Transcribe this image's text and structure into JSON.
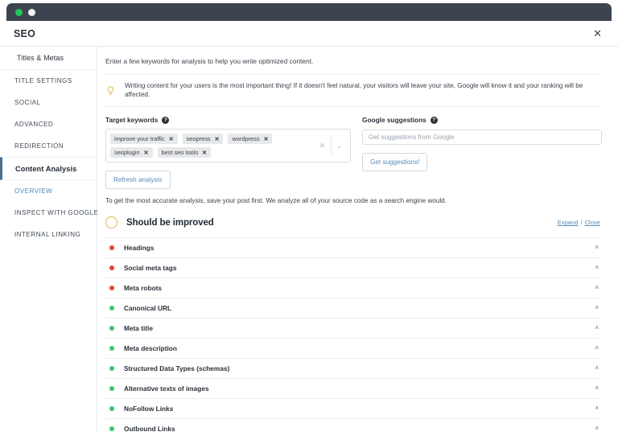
{
  "titlebar": {
    "dots": [
      "green",
      "white"
    ]
  },
  "header": {
    "title": "SEO",
    "close_label": "✕",
    "close_icon": "close-icon"
  },
  "sidebar": {
    "items": [
      {
        "label": "Titles & Metas",
        "type": "group",
        "active": false
      },
      {
        "label": "TITLE SETTINGS",
        "type": "item",
        "active": false
      },
      {
        "label": "SOCIAL",
        "type": "item",
        "active": false
      },
      {
        "label": "ADVANCED",
        "type": "item",
        "active": false
      },
      {
        "label": "REDIRECTION",
        "type": "item",
        "active": false
      },
      {
        "label": "Content Analysis",
        "type": "active",
        "active": true
      },
      {
        "label": "OVERVIEW",
        "type": "link",
        "active": false
      },
      {
        "label": "INSPECT WITH GOOGLE",
        "type": "item",
        "active": false
      },
      {
        "label": "INTERNAL LINKING",
        "type": "item",
        "active": false
      }
    ]
  },
  "main": {
    "intro": "Enter a few keywords for analysis to help you write optimized content.",
    "tip": {
      "icon": "lightbulb-icon",
      "text": "Writing content for your users is the most important thing! If it doesn't feel natural, your visitors will leave your site, Google will know it and your ranking will be affected."
    },
    "target_keywords": {
      "label": "Target keywords",
      "help_glyph": "?",
      "tags": [
        "improve your traffic",
        "seopress",
        "wordpress",
        "seoplugin",
        "best seo tools"
      ],
      "tag_remove_glyph": "✕",
      "clear_all_glyph": "✕",
      "dropdown_glyph": "⌄",
      "refresh_button": "Refresh analysis"
    },
    "google_suggestions": {
      "label": "Google suggestions",
      "help_glyph": "?",
      "input_value": "",
      "input_placeholder": "Get suggestions from Google",
      "button": "Get suggestions!"
    },
    "note": "To get the most accurate analysis, save your post first. We analyze all of your source code as a search engine would.",
    "analysis": {
      "status_title": "Should be improved",
      "status_color": "#ddb84f",
      "expand_label": "Expand",
      "separator": "/",
      "close_label": "Close",
      "caret_glyph": "˄",
      "colors": {
        "red": "#ea4335",
        "green": "#3fc46b"
      },
      "rows": [
        {
          "label": "Headings",
          "status": "red"
        },
        {
          "label": "Social meta tags",
          "status": "red"
        },
        {
          "label": "Meta robots",
          "status": "red"
        },
        {
          "label": "Canonical URL",
          "status": "green"
        },
        {
          "label": "Meta title",
          "status": "green"
        },
        {
          "label": "Meta description",
          "status": "green"
        },
        {
          "label": "Structured Data Types (schemas)",
          "status": "green"
        },
        {
          "label": "Alternative texts of images",
          "status": "green"
        },
        {
          "label": "NoFollow Links",
          "status": "green"
        },
        {
          "label": "Outbound Links",
          "status": "green"
        }
      ]
    }
  }
}
